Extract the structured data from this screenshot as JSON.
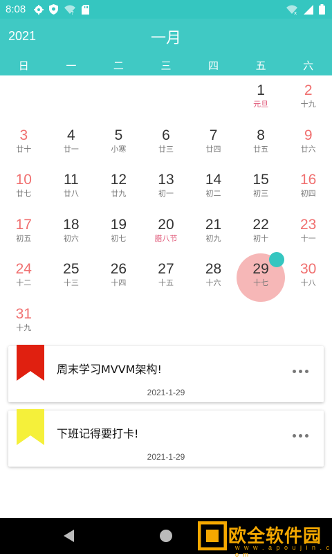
{
  "status": {
    "time": "8:08",
    "icons_left": [
      "gear-icon",
      "shield-icon",
      "wifi-question-icon",
      "sd-card-icon"
    ],
    "icons_right": [
      "wifi-x-icon",
      "signal-icon",
      "battery-icon"
    ]
  },
  "header": {
    "year": "2021",
    "month": "一月",
    "accent_color": "#40c9c4"
  },
  "weekdays": [
    "日",
    "一",
    "二",
    "三",
    "四",
    "五",
    "六"
  ],
  "calendar": {
    "selected": "29",
    "weeks": [
      [
        {
          "num": "",
          "sub": ""
        },
        {
          "num": "",
          "sub": ""
        },
        {
          "num": "",
          "sub": ""
        },
        {
          "num": "",
          "sub": ""
        },
        {
          "num": "",
          "sub": ""
        },
        {
          "num": "1",
          "sub": "元旦",
          "festival": true
        },
        {
          "num": "2",
          "sub": "十九"
        }
      ],
      [
        {
          "num": "3",
          "sub": "廿十"
        },
        {
          "num": "4",
          "sub": "廿一"
        },
        {
          "num": "5",
          "sub": "小寒"
        },
        {
          "num": "6",
          "sub": "廿三"
        },
        {
          "num": "7",
          "sub": "廿四"
        },
        {
          "num": "8",
          "sub": "廿五"
        },
        {
          "num": "9",
          "sub": "廿六"
        }
      ],
      [
        {
          "num": "10",
          "sub": "廿七"
        },
        {
          "num": "11",
          "sub": "廿八"
        },
        {
          "num": "12",
          "sub": "廿九"
        },
        {
          "num": "13",
          "sub": "初一"
        },
        {
          "num": "14",
          "sub": "初二"
        },
        {
          "num": "15",
          "sub": "初三"
        },
        {
          "num": "16",
          "sub": "初四"
        }
      ],
      [
        {
          "num": "17",
          "sub": "初五"
        },
        {
          "num": "18",
          "sub": "初六"
        },
        {
          "num": "19",
          "sub": "初七"
        },
        {
          "num": "20",
          "sub": "腊八节",
          "festival": true
        },
        {
          "num": "21",
          "sub": "初九"
        },
        {
          "num": "22",
          "sub": "初十"
        },
        {
          "num": "23",
          "sub": "十一"
        }
      ],
      [
        {
          "num": "24",
          "sub": "十二"
        },
        {
          "num": "25",
          "sub": "十三"
        },
        {
          "num": "26",
          "sub": "十四"
        },
        {
          "num": "27",
          "sub": "十五"
        },
        {
          "num": "28",
          "sub": "十六"
        },
        {
          "num": "29",
          "sub": "十七"
        },
        {
          "num": "30",
          "sub": "十八"
        }
      ],
      [
        {
          "num": "31",
          "sub": "十九"
        },
        {
          "num": "",
          "sub": ""
        },
        {
          "num": "",
          "sub": ""
        },
        {
          "num": "",
          "sub": ""
        },
        {
          "num": "",
          "sub": ""
        },
        {
          "num": "",
          "sub": ""
        },
        {
          "num": "",
          "sub": ""
        }
      ]
    ]
  },
  "tasks": [
    {
      "title": "周末学习MVVM架构!",
      "date": "2021-1-29",
      "flag_color": "#e02010",
      "more_icon": "more-horizontal-icon"
    },
    {
      "title": "下班记得要打卡!",
      "date": "2021-1-29",
      "flag_color": "#f5f03a",
      "more_icon": "more-horizontal-icon"
    }
  ],
  "watermark": {
    "text": "欧全软件园",
    "url": "w w w . a p o u j i n . c o m"
  }
}
